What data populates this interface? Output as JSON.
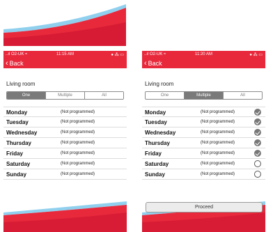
{
  "colors": {
    "brand_red": "#e8293c",
    "brand_blue": "#8fd0ee",
    "segment_active": "#7a7a7a"
  },
  "left_screen": {
    "status": {
      "carrier": "..ıl O2-UK ≈",
      "time": "11:15 AM",
      "icons": "● ⁂ ▭"
    },
    "back_label": "Back",
    "room_title": "Living room",
    "segments": [
      {
        "label": "One",
        "active": true
      },
      {
        "label": "Multiple",
        "active": false
      },
      {
        "label": "All",
        "active": false
      }
    ],
    "days": [
      {
        "name": "Monday",
        "status": "(Not programmed)"
      },
      {
        "name": "Tuesday",
        "status": "(Not programmed)"
      },
      {
        "name": "Wednesday",
        "status": "(Not programmed)"
      },
      {
        "name": "Thursday",
        "status": "(Not programmed)"
      },
      {
        "name": "Friday",
        "status": "(Not programmed)"
      },
      {
        "name": "Saturday",
        "status": "(Not programmed)"
      },
      {
        "name": "Sunday",
        "status": "(Not programmed)"
      }
    ]
  },
  "right_screen": {
    "status": {
      "carrier": "..ıl O2-UK ≈",
      "time": "11:20 AM",
      "icons": "● ⁂ ▭"
    },
    "back_label": "Back",
    "room_title": "Living room",
    "segments": [
      {
        "label": "One",
        "active": false
      },
      {
        "label": "Multiple",
        "active": true
      },
      {
        "label": "All",
        "active": false
      }
    ],
    "days": [
      {
        "name": "Monday",
        "status": "(Not programmed)",
        "checked": true
      },
      {
        "name": "Tuesday",
        "status": "(Not programmed)",
        "checked": true
      },
      {
        "name": "Wednesday",
        "status": "(Not programmed)",
        "checked": true
      },
      {
        "name": "Thursday",
        "status": "(Not programmed)",
        "checked": true
      },
      {
        "name": "Friday",
        "status": "(Not programmed)",
        "checked": true
      },
      {
        "name": "Saturday",
        "status": "(Not programmed)",
        "checked": false
      },
      {
        "name": "Sunday",
        "status": "(Not programmed)",
        "checked": false
      }
    ],
    "proceed_label": "Proceed"
  }
}
